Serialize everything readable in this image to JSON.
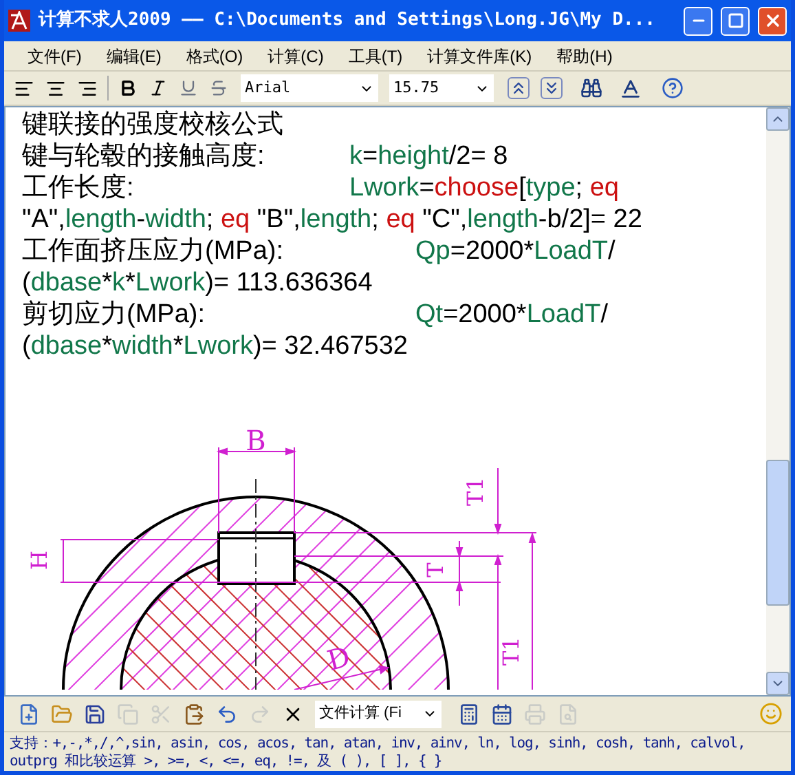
{
  "window": {
    "title": "计算不求人2009 —— C:\\Documents and Settings\\Long.JG\\My D..."
  },
  "menu": [
    "文件(F)",
    "编辑(E)",
    "格式(O)",
    "计算(C)",
    "工具(T)",
    "计算文件库(K)",
    "帮助(H)"
  ],
  "format_toolbar": {
    "font": "Arial",
    "size": "15.75"
  },
  "document": {
    "lines": [
      {
        "label": "键联接的强度校核公式"
      },
      {
        "kind": "formula",
        "label": "键与轮毂的接触高度:",
        "parts": [
          {
            "kind": "var",
            "text": "k"
          },
          {
            "kind": "plain",
            "text": "="
          },
          {
            "kind": "var",
            "text": "height"
          },
          {
            "kind": "plain",
            "text": "/2= 8"
          }
        ]
      },
      {
        "kind": "formula",
        "label": "工作长度:",
        "parts": [
          {
            "kind": "var",
            "text": "Lwork"
          },
          {
            "kind": "plain",
            "text": "="
          },
          {
            "kind": "func",
            "text": "choose"
          },
          {
            "kind": "plain",
            "text": "["
          },
          {
            "kind": "var",
            "text": "type"
          },
          {
            "kind": "plain",
            "text": "; "
          },
          {
            "kind": "func",
            "text": "eq"
          }
        ]
      },
      {
        "parts": [
          {
            "kind": "plain",
            "text": "\"A\","
          },
          {
            "kind": "var",
            "text": "length"
          },
          {
            "kind": "plain",
            "text": "-"
          },
          {
            "kind": "var",
            "text": "width"
          },
          {
            "kind": "plain",
            "text": "; "
          },
          {
            "kind": "func",
            "text": "eq"
          },
          {
            "kind": "plain",
            "text": " \"B\","
          },
          {
            "kind": "var",
            "text": "length"
          },
          {
            "kind": "plain",
            "text": "; "
          },
          {
            "kind": "func",
            "text": "eq"
          },
          {
            "kind": "plain",
            "text": " \"C\","
          },
          {
            "kind": "var",
            "text": "length"
          },
          {
            "kind": "plain",
            "text": "-b/2]= 22"
          }
        ]
      },
      {
        "kind": "formula_wide",
        "label": "工作面挤压应力(MPa):",
        "parts": [
          {
            "kind": "var",
            "text": "Qp"
          },
          {
            "kind": "plain",
            "text": "=2000*"
          },
          {
            "kind": "var",
            "text": "LoadT"
          },
          {
            "kind": "plain",
            "text": "/"
          }
        ]
      },
      {
        "parts": [
          {
            "kind": "plain",
            "text": "("
          },
          {
            "kind": "var",
            "text": "dbase"
          },
          {
            "kind": "plain",
            "text": "*"
          },
          {
            "kind": "var",
            "text": "k"
          },
          {
            "kind": "plain",
            "text": "*"
          },
          {
            "kind": "var",
            "text": "Lwork"
          },
          {
            "kind": "plain",
            "text": ")= 113.636364"
          }
        ]
      },
      {
        "kind": "formula_wide",
        "label": "剪切应力(MPa):",
        "parts": [
          {
            "kind": "var",
            "text": "Qt"
          },
          {
            "kind": "plain",
            "text": "=2000*"
          },
          {
            "kind": "var",
            "text": "LoadT"
          },
          {
            "kind": "plain",
            "text": "/"
          }
        ]
      },
      {
        "parts": [
          {
            "kind": "plain",
            "text": "("
          },
          {
            "kind": "var",
            "text": "dbase"
          },
          {
            "kind": "plain",
            "text": "*"
          },
          {
            "kind": "var",
            "text": "width"
          },
          {
            "kind": "plain",
            "text": "*"
          },
          {
            "kind": "var",
            "text": "Lwork"
          },
          {
            "kind": "plain",
            "text": ")= 32.467532"
          }
        ]
      }
    ],
    "drawing_labels": [
      "B",
      "H",
      "T",
      "T1",
      "T1",
      "D"
    ]
  },
  "main_toolbar": {
    "buttons": [
      {
        "kind": "new",
        "disabled": false
      },
      {
        "kind": "open",
        "disabled": false
      },
      {
        "kind": "save",
        "disabled": false
      },
      {
        "kind": "copy",
        "disabled": true
      },
      {
        "kind": "cut",
        "disabled": true
      },
      {
        "kind": "paste",
        "disabled": false
      },
      {
        "kind": "undo",
        "disabled": false
      },
      {
        "kind": "redo",
        "disabled": true
      },
      {
        "kind": "stop",
        "disabled": false
      }
    ],
    "mode": "文件计算 (Fi",
    "tools": [
      {
        "kind": "calculator",
        "disabled": false
      },
      {
        "kind": "calendar",
        "disabled": false
      },
      {
        "kind": "print",
        "disabled": true
      },
      {
        "kind": "preview",
        "disabled": true
      }
    ]
  },
  "status_bar": "支持：+,-,*,/,^,sin, asin, cos, acos, tan, atan, inv, ainv, ln, log, sinh, cosh, tanh, calvol, outprg 和比较运算 >, >=, <, <=, eq, !=,  及 ( ), [ ], { }"
}
